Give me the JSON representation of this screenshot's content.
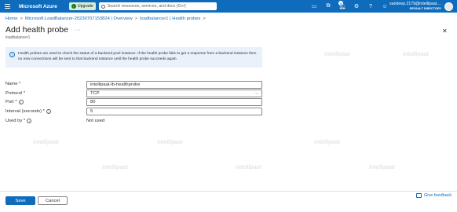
{
  "topbar": {
    "brand": "Microsoft Azure",
    "upgrade_label": "Upgrade",
    "search_placeholder": "Search resources, services, and docs (G+/)",
    "notification_count": "3",
    "account_name": "sandeep.2179@intellipaat....",
    "account_directory": "DEFAULT DIRECTORY"
  },
  "breadcrumb": {
    "items": [
      "Home",
      "Microsoft.LoadBalancer-20230707153824 | Overview",
      "loadbalancer1 | Health probes"
    ],
    "separator": ">"
  },
  "page": {
    "title": "Add health probe",
    "subtitle": "loadbalancer1",
    "more_label": "···",
    "close_label": "✕"
  },
  "info": {
    "text": "Health probes are used to check the status of a backend pool instance. If the health probe fails to get a response from a backend instance then no new connections will be sent to that backend instance until the health probe succeeds again."
  },
  "form": {
    "name_label": "Name *",
    "name_value": "intellipaat-lb-healthprobe",
    "protocol_label": "Protocol *",
    "protocol_value": "TCP",
    "port_label": "Port *",
    "port_value": "80",
    "interval_label": "Interval (seconds) *",
    "interval_value": "5",
    "usedby_label": "Used by *",
    "usedby_value": "Not used"
  },
  "footer": {
    "save_label": "Save",
    "cancel_label": "Cancel",
    "feedback_label": "Give feedback"
  },
  "watermark": "intellipaat",
  "colors": {
    "accent": "#0f6cbd",
    "info_bg": "#e9f1fb",
    "upgrade_bg": "#d7ecd9"
  }
}
